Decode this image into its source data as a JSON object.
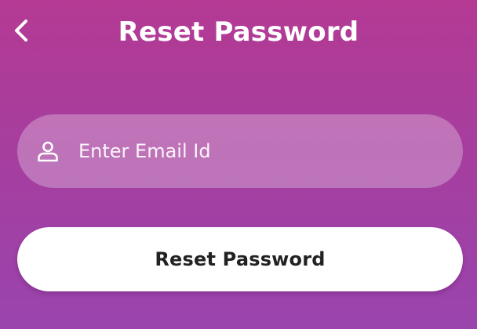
{
  "header": {
    "title": "Reset Password",
    "back_icon": "chevron-left-icon"
  },
  "form": {
    "email": {
      "placeholder": "Enter Email Id",
      "value": "",
      "icon": "user-icon"
    },
    "submit_label": "Reset Password"
  },
  "colors": {
    "background_top": "#b43a94",
    "background_bottom": "#9a44ae",
    "button_background": "#ffffff",
    "button_text": "#222222",
    "title_text": "#ffffff"
  }
}
